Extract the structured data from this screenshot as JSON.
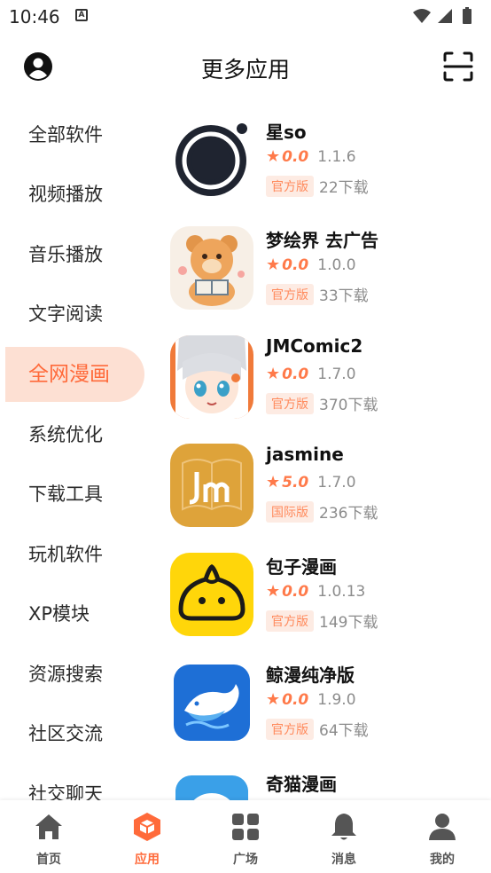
{
  "status_bar": {
    "time": "10:46",
    "notif_glyph": "A"
  },
  "header": {
    "title": "更多应用",
    "left_icon": "user-avatar-icon",
    "right_icon": "scan-icon"
  },
  "sidebar": {
    "items": [
      {
        "label": "全部软件",
        "active": false
      },
      {
        "label": "视频播放",
        "active": false
      },
      {
        "label": "音乐播放",
        "active": false
      },
      {
        "label": "文字阅读",
        "active": false
      },
      {
        "label": "全网漫画",
        "active": true
      },
      {
        "label": "系统优化",
        "active": false
      },
      {
        "label": "下载工具",
        "active": false
      },
      {
        "label": "玩机软件",
        "active": false
      },
      {
        "label": "XP模块",
        "active": false
      },
      {
        "label": "资源搜索",
        "active": false
      },
      {
        "label": "社区交流",
        "active": false
      },
      {
        "label": "社交聊天",
        "active": false
      }
    ]
  },
  "apps": [
    {
      "name": "星so",
      "score": "0.0",
      "version": "1.1.6",
      "tag": "官方版",
      "downloads": "22下载",
      "icon": "xingso-icon"
    },
    {
      "name": "梦绘界 去广告",
      "score": "0.0",
      "version": "1.0.0",
      "tag": "官方版",
      "downloads": "33下载",
      "icon": "menghuijie-bear-icon"
    },
    {
      "name": "JMComic2",
      "score": "0.0",
      "version": "1.7.0",
      "tag": "官方版",
      "downloads": "370下载",
      "icon": "jmcomic-anime-girl-icon"
    },
    {
      "name": "jasmine",
      "score": "5.0",
      "version": "1.7.0",
      "tag": "国际版",
      "downloads": "236下载",
      "icon": "jasmine-jm-book-icon"
    },
    {
      "name": "包子漫画",
      "score": "0.0",
      "version": "1.0.13",
      "tag": "官方版",
      "downloads": "149下载",
      "icon": "baozi-bun-icon"
    },
    {
      "name": "鲸漫纯净版",
      "score": "0.0",
      "version": "1.9.0",
      "tag": "官方版",
      "downloads": "64下载",
      "icon": "jingman-whale-icon"
    },
    {
      "name": "奇猫漫画",
      "score": "",
      "version": "",
      "tag": "",
      "downloads": "",
      "icon": "qimao-icon"
    }
  ],
  "bottom_nav": {
    "items": [
      {
        "label": "首页",
        "icon": "home-icon",
        "active": false
      },
      {
        "label": "应用",
        "icon": "apps-cube-icon",
        "active": true
      },
      {
        "label": "广场",
        "icon": "grid-square-icon",
        "active": false
      },
      {
        "label": "消息",
        "icon": "bell-icon",
        "active": false
      },
      {
        "label": "我的",
        "icon": "person-icon",
        "active": false
      }
    ]
  },
  "colors": {
    "accent": "#ff6a3a",
    "active_bg": "#fde0d3",
    "tag_bg": "#fdebe3",
    "muted": "#8c8c8c"
  }
}
